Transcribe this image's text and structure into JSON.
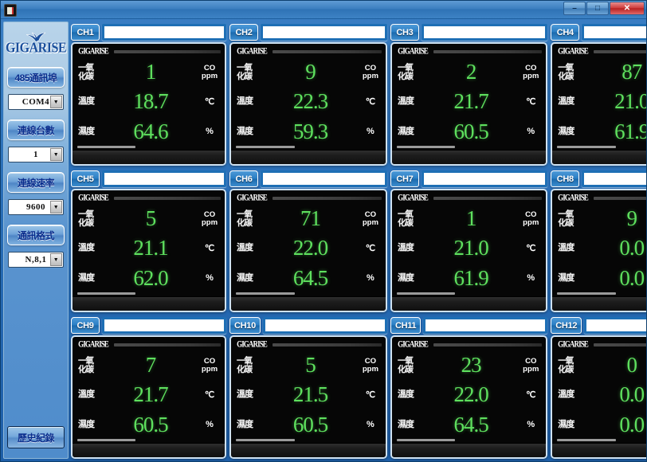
{
  "window": {
    "title": "",
    "app_icon": "app-icon",
    "buttons": {
      "minimize": "–",
      "maximize": "□",
      "close": "✕"
    }
  },
  "sidebar": {
    "logo": "GIGARISE",
    "controls": [
      {
        "button_label": "485通訊埠",
        "select_value": "COM4",
        "name": "com-port"
      },
      {
        "button_label": "連線台數",
        "select_value": "1",
        "name": "device-count"
      },
      {
        "button_label": "連線速率",
        "select_value": "9600",
        "name": "baud-rate"
      },
      {
        "button_label": "通訊格式",
        "select_value": "N,8,1",
        "name": "data-format"
      }
    ],
    "history_button": "歷史紀錄"
  },
  "panel_labels": {
    "brand_mark": "GIGARISE",
    "co_label_line1": "一氧",
    "co_label_line2": "化碳",
    "temp_label": "溫度",
    "humidity_label": "濕度",
    "co_unit_line1": "CO",
    "co_unit_line2": "ppm",
    "temp_unit": "℃",
    "humidity_unit": "%"
  },
  "colors": {
    "value_green": "#5ee05e",
    "panel_black": "#060606",
    "accent_blue": "#2a7ec4",
    "window_blue": "#2a6fb8"
  },
  "channels": [
    {
      "tag": "CH1",
      "name": "",
      "placeholder": "",
      "co": "1",
      "temp": "18.7",
      "humidity": "64.6"
    },
    {
      "tag": "CH2",
      "name": "",
      "placeholder": "",
      "co": "9",
      "temp": "22.3",
      "humidity": "59.3"
    },
    {
      "tag": "CH3",
      "name": "",
      "placeholder": "",
      "co": "2",
      "temp": "21.7",
      "humidity": "60.5"
    },
    {
      "tag": "CH4",
      "name": "",
      "placeholder": "",
      "co": "87",
      "temp": "21.0",
      "humidity": "61.9"
    },
    {
      "tag": "CH5",
      "name": "",
      "placeholder": "",
      "co": "5",
      "temp": "21.1",
      "humidity": "62.0"
    },
    {
      "tag": "CH6",
      "name": "",
      "placeholder": "",
      "co": "71",
      "temp": "22.0",
      "humidity": "64.5"
    },
    {
      "tag": "CH7",
      "name": "",
      "placeholder": "",
      "co": "1",
      "temp": "21.0",
      "humidity": "61.9"
    },
    {
      "tag": "CH8",
      "name": "",
      "placeholder": "",
      "co": "9",
      "temp": "0.0",
      "humidity": "0.0"
    },
    {
      "tag": "CH9",
      "name": "",
      "placeholder": "",
      "co": "7",
      "temp": "21.7",
      "humidity": "60.5"
    },
    {
      "tag": "CH10",
      "name": "",
      "placeholder": "",
      "co": "5",
      "temp": "21.5",
      "humidity": "60.5"
    },
    {
      "tag": "CH11",
      "name": "",
      "placeholder": "",
      "co": "23",
      "temp": "22.0",
      "humidity": "64.5"
    },
    {
      "tag": "CH12",
      "name": "",
      "placeholder": "",
      "co": "0",
      "temp": "0.0",
      "humidity": "0.0"
    }
  ]
}
